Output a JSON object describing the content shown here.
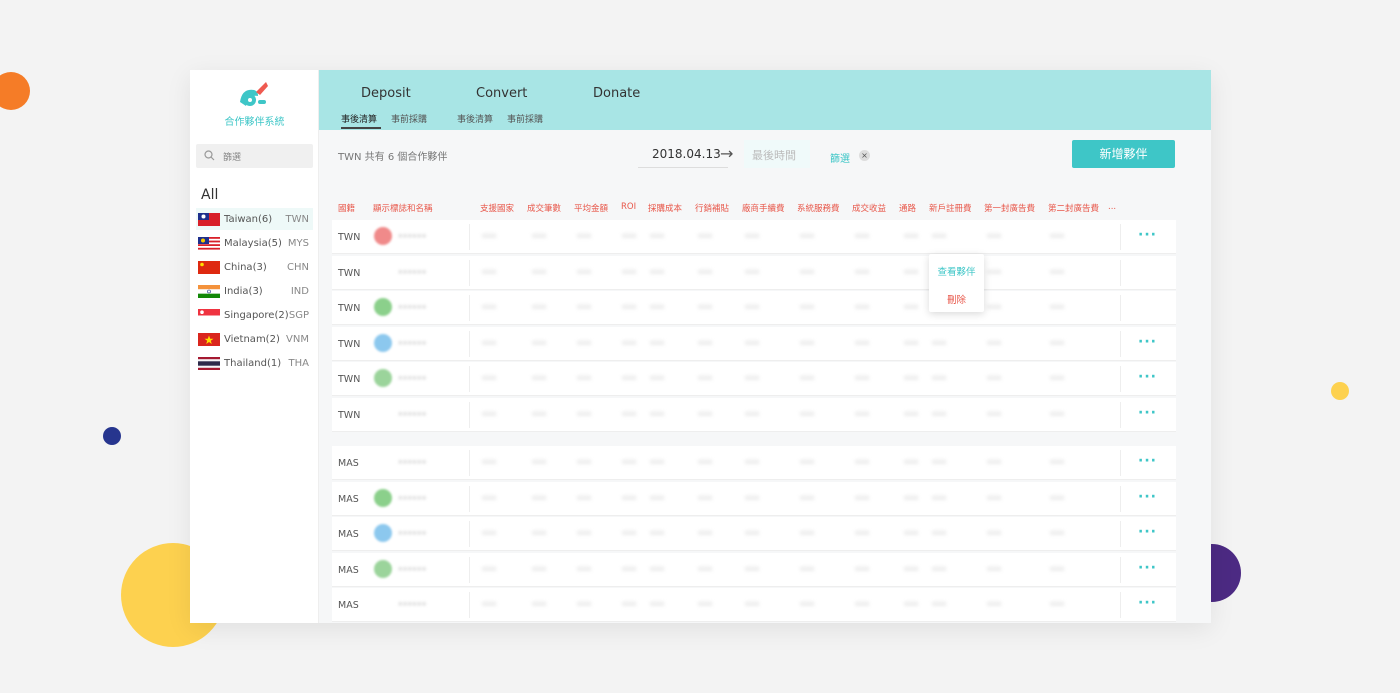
{
  "app": {
    "name": "合作夥伴系統"
  },
  "search": {
    "placeholder": "篩選"
  },
  "sidebar": {
    "all_label": "All",
    "countries": [
      {
        "name": "Taiwan(6)",
        "code": "TWN",
        "flag": "taiwan-flag-icon"
      },
      {
        "name": "Malaysia(5)",
        "code": "MYS",
        "flag": "malaysia-flag-icon"
      },
      {
        "name": "China(3)",
        "code": "CHN",
        "flag": "china-flag-icon"
      },
      {
        "name": "India(3)",
        "code": "IND",
        "flag": "india-flag-icon"
      },
      {
        "name": "Singapore(2)",
        "code": "SGP",
        "flag": "singapore-flag-icon"
      },
      {
        "name": "Vietnam(2)",
        "code": "VNM",
        "flag": "vietnam-flag-icon"
      },
      {
        "name": "Thailand(1)",
        "code": "THA",
        "flag": "thailand-flag-icon"
      }
    ]
  },
  "tabs": [
    {
      "label": "Deposit",
      "subtabs": [
        "事後清算",
        "事前採購"
      ]
    },
    {
      "label": "Convert",
      "subtabs": [
        "事後清算",
        "事前採購"
      ]
    },
    {
      "label": "Donate",
      "subtabs": []
    }
  ],
  "toolbar": {
    "summary": "TWN 共有 6 個合作夥伴",
    "date_from": "2018.04.13",
    "date_to_placeholder": "最後時間",
    "filter_label": "篩選",
    "clear_label": "×",
    "add_button": "新增夥伴"
  },
  "table": {
    "headers": [
      "國籍",
      "顯示標誌和名稱",
      "支援國家",
      "成交筆數",
      "平均金額",
      "ROI",
      "採購成本",
      "行銷補貼",
      "廠商手續費",
      "系統服務費",
      "成交收益",
      "通路",
      "新戶註冊費",
      "第一封廣告費",
      "第二封廣告費",
      "..."
    ],
    "groups": [
      {
        "rows": [
          {
            "country": "TWN",
            "icon_color": "#f08a8a"
          },
          {
            "country": "TWN",
            "icon_color": "#ffffff"
          },
          {
            "country": "TWN",
            "icon_color": "#8bd08b"
          },
          {
            "country": "TWN",
            "icon_color": "#8cc8ee"
          },
          {
            "country": "TWN",
            "icon_color": "#9bd49b"
          },
          {
            "country": "TWN",
            "icon_color": "#ffffff"
          }
        ]
      },
      {
        "rows": [
          {
            "country": "MAS",
            "icon_color": "#ffffff"
          },
          {
            "country": "MAS",
            "icon_color": "#8bd08b"
          },
          {
            "country": "MAS",
            "icon_color": "#8cc8ee"
          },
          {
            "country": "MAS",
            "icon_color": "#9bd49b"
          },
          {
            "country": "MAS",
            "icon_color": "#ffffff"
          }
        ]
      }
    ],
    "more_label": "···"
  },
  "row_menu": {
    "view_label": "查看夥伴",
    "delete_label": "刪除"
  },
  "colors": {
    "accent": "#3ec6c7",
    "header_red": "#e8574a",
    "topbar": "#a8e5e5"
  }
}
